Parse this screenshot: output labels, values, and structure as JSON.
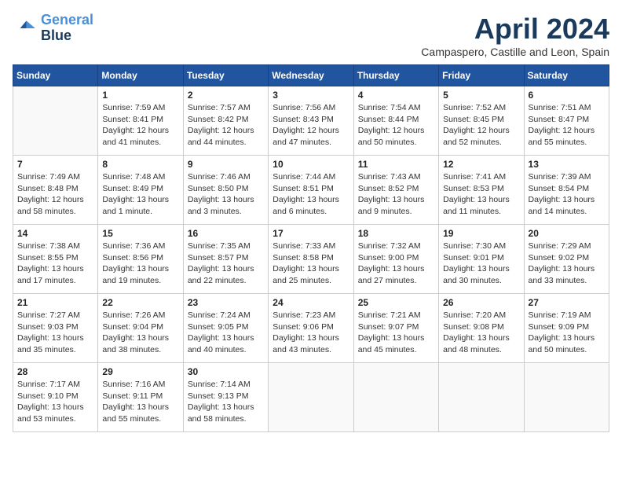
{
  "header": {
    "logo_line1": "General",
    "logo_line2": "Blue",
    "month_title": "April 2024",
    "subtitle": "Campaspero, Castille and Leon, Spain"
  },
  "weekdays": [
    "Sunday",
    "Monday",
    "Tuesday",
    "Wednesday",
    "Thursday",
    "Friday",
    "Saturday"
  ],
  "weeks": [
    [
      {
        "day": "",
        "info": ""
      },
      {
        "day": "1",
        "info": "Sunrise: 7:59 AM\nSunset: 8:41 PM\nDaylight: 12 hours\nand 41 minutes."
      },
      {
        "day": "2",
        "info": "Sunrise: 7:57 AM\nSunset: 8:42 PM\nDaylight: 12 hours\nand 44 minutes."
      },
      {
        "day": "3",
        "info": "Sunrise: 7:56 AM\nSunset: 8:43 PM\nDaylight: 12 hours\nand 47 minutes."
      },
      {
        "day": "4",
        "info": "Sunrise: 7:54 AM\nSunset: 8:44 PM\nDaylight: 12 hours\nand 50 minutes."
      },
      {
        "day": "5",
        "info": "Sunrise: 7:52 AM\nSunset: 8:45 PM\nDaylight: 12 hours\nand 52 minutes."
      },
      {
        "day": "6",
        "info": "Sunrise: 7:51 AM\nSunset: 8:47 PM\nDaylight: 12 hours\nand 55 minutes."
      }
    ],
    [
      {
        "day": "7",
        "info": "Sunrise: 7:49 AM\nSunset: 8:48 PM\nDaylight: 12 hours\nand 58 minutes."
      },
      {
        "day": "8",
        "info": "Sunrise: 7:48 AM\nSunset: 8:49 PM\nDaylight: 13 hours\nand 1 minute."
      },
      {
        "day": "9",
        "info": "Sunrise: 7:46 AM\nSunset: 8:50 PM\nDaylight: 13 hours\nand 3 minutes."
      },
      {
        "day": "10",
        "info": "Sunrise: 7:44 AM\nSunset: 8:51 PM\nDaylight: 13 hours\nand 6 minutes."
      },
      {
        "day": "11",
        "info": "Sunrise: 7:43 AM\nSunset: 8:52 PM\nDaylight: 13 hours\nand 9 minutes."
      },
      {
        "day": "12",
        "info": "Sunrise: 7:41 AM\nSunset: 8:53 PM\nDaylight: 13 hours\nand 11 minutes."
      },
      {
        "day": "13",
        "info": "Sunrise: 7:39 AM\nSunset: 8:54 PM\nDaylight: 13 hours\nand 14 minutes."
      }
    ],
    [
      {
        "day": "14",
        "info": "Sunrise: 7:38 AM\nSunset: 8:55 PM\nDaylight: 13 hours\nand 17 minutes."
      },
      {
        "day": "15",
        "info": "Sunrise: 7:36 AM\nSunset: 8:56 PM\nDaylight: 13 hours\nand 19 minutes."
      },
      {
        "day": "16",
        "info": "Sunrise: 7:35 AM\nSunset: 8:57 PM\nDaylight: 13 hours\nand 22 minutes."
      },
      {
        "day": "17",
        "info": "Sunrise: 7:33 AM\nSunset: 8:58 PM\nDaylight: 13 hours\nand 25 minutes."
      },
      {
        "day": "18",
        "info": "Sunrise: 7:32 AM\nSunset: 9:00 PM\nDaylight: 13 hours\nand 27 minutes."
      },
      {
        "day": "19",
        "info": "Sunrise: 7:30 AM\nSunset: 9:01 PM\nDaylight: 13 hours\nand 30 minutes."
      },
      {
        "day": "20",
        "info": "Sunrise: 7:29 AM\nSunset: 9:02 PM\nDaylight: 13 hours\nand 33 minutes."
      }
    ],
    [
      {
        "day": "21",
        "info": "Sunrise: 7:27 AM\nSunset: 9:03 PM\nDaylight: 13 hours\nand 35 minutes."
      },
      {
        "day": "22",
        "info": "Sunrise: 7:26 AM\nSunset: 9:04 PM\nDaylight: 13 hours\nand 38 minutes."
      },
      {
        "day": "23",
        "info": "Sunrise: 7:24 AM\nSunset: 9:05 PM\nDaylight: 13 hours\nand 40 minutes."
      },
      {
        "day": "24",
        "info": "Sunrise: 7:23 AM\nSunset: 9:06 PM\nDaylight: 13 hours\nand 43 minutes."
      },
      {
        "day": "25",
        "info": "Sunrise: 7:21 AM\nSunset: 9:07 PM\nDaylight: 13 hours\nand 45 minutes."
      },
      {
        "day": "26",
        "info": "Sunrise: 7:20 AM\nSunset: 9:08 PM\nDaylight: 13 hours\nand 48 minutes."
      },
      {
        "day": "27",
        "info": "Sunrise: 7:19 AM\nSunset: 9:09 PM\nDaylight: 13 hours\nand 50 minutes."
      }
    ],
    [
      {
        "day": "28",
        "info": "Sunrise: 7:17 AM\nSunset: 9:10 PM\nDaylight: 13 hours\nand 53 minutes."
      },
      {
        "day": "29",
        "info": "Sunrise: 7:16 AM\nSunset: 9:11 PM\nDaylight: 13 hours\nand 55 minutes."
      },
      {
        "day": "30",
        "info": "Sunrise: 7:14 AM\nSunset: 9:13 PM\nDaylight: 13 hours\nand 58 minutes."
      },
      {
        "day": "",
        "info": ""
      },
      {
        "day": "",
        "info": ""
      },
      {
        "day": "",
        "info": ""
      },
      {
        "day": "",
        "info": ""
      }
    ]
  ]
}
